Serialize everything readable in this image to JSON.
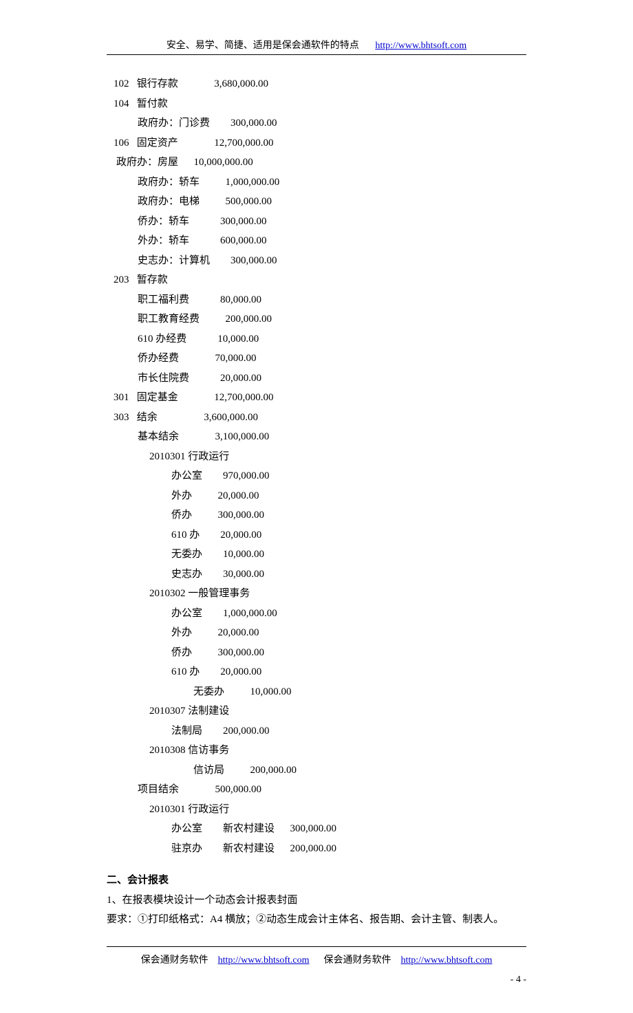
{
  "header": {
    "text": "安全、易学、简捷、适用是保会通软件的特点",
    "url": "http://www.bhtsoft.com"
  },
  "accounts": [
    {
      "indent": "ind0",
      "label": "102   银行存款",
      "amount": "3,680,000.00",
      "pad": 14
    },
    {
      "indent": "ind0",
      "label": "104   暂付款",
      "amount": "",
      "pad": 0
    },
    {
      "indent": "ind1",
      "label": "政府办：门诊费",
      "amount": "300,000.00",
      "pad": 8
    },
    {
      "indent": "ind0",
      "label": "106   固定资产",
      "amount": "12,700,000.00",
      "pad": 14
    },
    {
      "indent": "special-fangwu",
      "label": "政府办：房屋",
      "amount": "10,000,000.00",
      "pad": 6
    },
    {
      "indent": "ind1",
      "label": "政府办：轿车",
      "amount": "1,000,000.00",
      "pad": 10
    },
    {
      "indent": "ind1",
      "label": "政府办：电梯",
      "amount": "500,000.00",
      "pad": 10
    },
    {
      "indent": "ind1",
      "label": "侨办：轿车",
      "amount": "300,000.00",
      "pad": 12
    },
    {
      "indent": "ind1",
      "label": "外办：轿车",
      "amount": "600,000.00",
      "pad": 12
    },
    {
      "indent": "ind1",
      "label": "史志办：计算机",
      "amount": "300,000.00",
      "pad": 8
    },
    {
      "indent": "ind0",
      "label": "203   暂存款",
      "amount": "",
      "pad": 0
    },
    {
      "indent": "ind1",
      "label": "职工福利费",
      "amount": "80,000.00",
      "pad": 12
    },
    {
      "indent": "ind1",
      "label": "职工教育经费",
      "amount": "200,000.00",
      "pad": 10
    },
    {
      "indent": "ind1",
      "label": "610 办经费",
      "amount": "10,000.00",
      "pad": 12
    },
    {
      "indent": "ind1",
      "label": "侨办经费",
      "amount": "70,000.00",
      "pad": 14
    },
    {
      "indent": "ind1",
      "label": "市长住院费",
      "amount": "20,000.00",
      "pad": 12
    },
    {
      "indent": "ind0",
      "label": "301   固定基金",
      "amount": "12,700,000.00",
      "pad": 14
    },
    {
      "indent": "ind0",
      "label": "303   结余",
      "amount": "3,600,000.00",
      "pad": 18
    },
    {
      "indent": "ind1",
      "label": "基本结余",
      "amount": "3,100,000.00",
      "pad": 14
    },
    {
      "indent": "ind2",
      "label": "2010301 行政运行",
      "amount": "",
      "pad": 0
    },
    {
      "indent": "ind3",
      "label": "办公室",
      "amount": "970,000.00",
      "pad": 8
    },
    {
      "indent": "ind3",
      "label": "外办",
      "amount": "20,000.00",
      "pad": 10
    },
    {
      "indent": "ind3",
      "label": "侨办",
      "amount": "300,000.00",
      "pad": 10
    },
    {
      "indent": "ind3",
      "label": "610 办",
      "amount": "20,000.00",
      "pad": 8
    },
    {
      "indent": "ind3",
      "label": "无委办",
      "amount": "10,000.00",
      "pad": 8
    },
    {
      "indent": "ind3",
      "label": "史志办",
      "amount": "30,000.00",
      "pad": 8
    },
    {
      "indent": "ind2",
      "label": "2010302 一般管理事务",
      "amount": "",
      "pad": 0
    },
    {
      "indent": "ind3",
      "label": "办公室",
      "amount": "1,000,000.00",
      "pad": 8
    },
    {
      "indent": "ind3",
      "label": "外办",
      "amount": "20,000.00",
      "pad": 10
    },
    {
      "indent": "ind3",
      "label": "侨办",
      "amount": "300,000.00",
      "pad": 10
    },
    {
      "indent": "ind3",
      "label": "610 办",
      "amount": "20,000.00",
      "pad": 8
    },
    {
      "indent": "ind4",
      "label": "无委办",
      "amount": "10,000.00",
      "pad": 10
    },
    {
      "indent": "ind2",
      "label": "2010307 法制建设",
      "amount": "",
      "pad": 0
    },
    {
      "indent": "ind3",
      "label": "法制局",
      "amount": "200,000.00",
      "pad": 8
    },
    {
      "indent": "ind2",
      "label": "2010308 信访事务",
      "amount": "",
      "pad": 0
    },
    {
      "indent": "ind4",
      "label": "信访局",
      "amount": "200,000.00",
      "pad": 10
    },
    {
      "indent": "ind1",
      "label": "项目结余",
      "amount": "500,000.00",
      "pad": 14
    },
    {
      "indent": "ind2",
      "label": "2010301 行政运行",
      "amount": "",
      "pad": 0
    },
    {
      "indent": "ind3",
      "label": "办公室",
      "amount": "新农村建设",
      "pad": 8,
      "extra": "300,000.00",
      "extraPad": 6
    },
    {
      "indent": "ind3",
      "label": "驻京办",
      "amount": "新农村建设",
      "pad": 8,
      "extra": "200,000.00",
      "extraPad": 6
    }
  ],
  "section2": {
    "title": "二、会计报表",
    "line1": "1、在报表模块设计一个动态会计报表封面",
    "line2": "要求：①打印纸格式：A4 横放；②动态生成会计主体名、报告期、会计主管、制表人。"
  },
  "footer": {
    "text1": "保会通财务软件",
    "url1": "http://www.bhtsoft.com",
    "text2": "保会通财务软件",
    "url2": "http://www.bhtsoft.com"
  },
  "pageNum": "- 4 -"
}
